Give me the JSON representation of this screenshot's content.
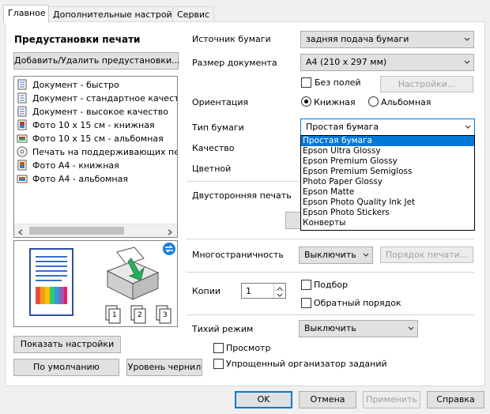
{
  "tabs": [
    "Главное",
    "Дополнительные настройки",
    "Сервис"
  ],
  "left": {
    "presets_title": "Предустановки печати",
    "add_remove_button": "Добавить/Удалить предустановки...",
    "presets": [
      "Документ - быстро",
      "Документ - стандартное качество",
      "Документ - высокое качество",
      "Фото 10 x 15 см - книжная",
      "Фото 10 x 15 см - альбомная",
      "Печать на поддерживающих печат",
      "Фото A4 - книжная",
      "Фото A4 - альбомная"
    ],
    "show_settings_button": "Показать настройки",
    "defaults_button": "По умолчанию",
    "ink_levels_button": "Уровень чернил"
  },
  "form": {
    "paper_source_label": "Источник бумаги",
    "paper_source_value": "задняя подача бумаги",
    "doc_size_label": "Размер документа",
    "doc_size_value": "A4 (210 x 297 мм)",
    "borderless_label": "Без полей",
    "settings_button": "Настройки...",
    "orientation_label": "Ориентация",
    "portrait_label": "Книжная",
    "landscape_label": "Альбомная",
    "paper_type_label": "Тип бумаги",
    "paper_type_value": "Простая бумага",
    "quality_label": "Качество",
    "color_label": "Цветной",
    "duplex_label": "Двусторонняя печать",
    "multipage_label": "Многостраничность",
    "multipage_value": "Выключить",
    "page_order_button": "Порядок печати...",
    "copies_label": "Копии",
    "copies_value": "1",
    "collate_label": "Подбор",
    "reverse_label": "Обратный порядок",
    "quiet_label": "Тихий режим",
    "quiet_value": "Выключить",
    "preview_label": "Просмотр",
    "jobs_label": "Упрощенный организатор заданий"
  },
  "paper_type_options": [
    "Простая бумага",
    "Epson Ultra Glossy",
    "Epson Premium Glossy",
    "Epson Premium Semigloss",
    "Photo Paper Glossy",
    "Epson Matte",
    "Epson Photo Quality Ink Jet",
    "Epson Photo Stickers",
    "Конверты"
  ],
  "footer": {
    "ok": "OK",
    "cancel": "Отмена",
    "apply": "Применить",
    "help": "Справка"
  },
  "collate_numbers": [
    "1",
    "2",
    "3"
  ]
}
